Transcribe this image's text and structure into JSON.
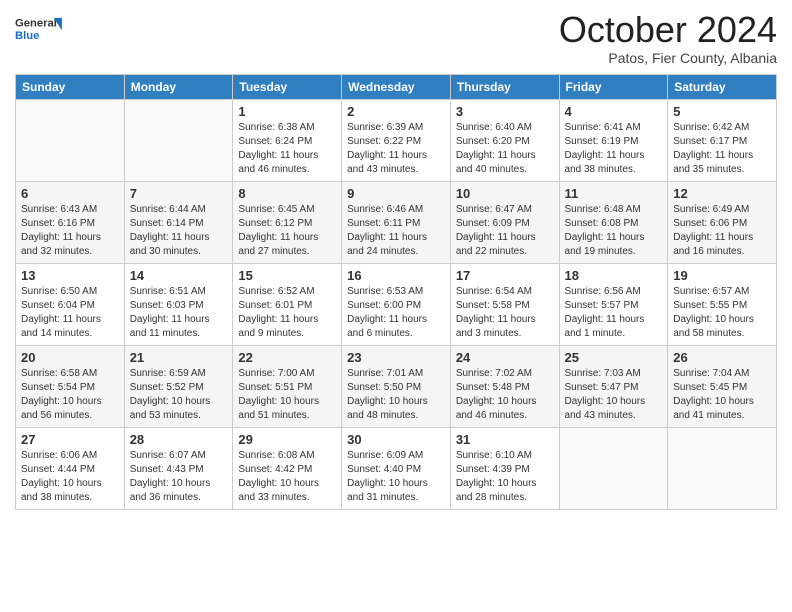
{
  "header": {
    "logo_general": "General",
    "logo_blue": "Blue",
    "month": "October 2024",
    "location": "Patos, Fier County, Albania"
  },
  "weekdays": [
    "Sunday",
    "Monday",
    "Tuesday",
    "Wednesday",
    "Thursday",
    "Friday",
    "Saturday"
  ],
  "weeks": [
    [
      {
        "day": "",
        "sunrise": "",
        "sunset": "",
        "daylight": ""
      },
      {
        "day": "",
        "sunrise": "",
        "sunset": "",
        "daylight": ""
      },
      {
        "day": "1",
        "sunrise": "Sunrise: 6:38 AM",
        "sunset": "Sunset: 6:24 PM",
        "daylight": "Daylight: 11 hours and 46 minutes."
      },
      {
        "day": "2",
        "sunrise": "Sunrise: 6:39 AM",
        "sunset": "Sunset: 6:22 PM",
        "daylight": "Daylight: 11 hours and 43 minutes."
      },
      {
        "day": "3",
        "sunrise": "Sunrise: 6:40 AM",
        "sunset": "Sunset: 6:20 PM",
        "daylight": "Daylight: 11 hours and 40 minutes."
      },
      {
        "day": "4",
        "sunrise": "Sunrise: 6:41 AM",
        "sunset": "Sunset: 6:19 PM",
        "daylight": "Daylight: 11 hours and 38 minutes."
      },
      {
        "day": "5",
        "sunrise": "Sunrise: 6:42 AM",
        "sunset": "Sunset: 6:17 PM",
        "daylight": "Daylight: 11 hours and 35 minutes."
      }
    ],
    [
      {
        "day": "6",
        "sunrise": "Sunrise: 6:43 AM",
        "sunset": "Sunset: 6:16 PM",
        "daylight": "Daylight: 11 hours and 32 minutes."
      },
      {
        "day": "7",
        "sunrise": "Sunrise: 6:44 AM",
        "sunset": "Sunset: 6:14 PM",
        "daylight": "Daylight: 11 hours and 30 minutes."
      },
      {
        "day": "8",
        "sunrise": "Sunrise: 6:45 AM",
        "sunset": "Sunset: 6:12 PM",
        "daylight": "Daylight: 11 hours and 27 minutes."
      },
      {
        "day": "9",
        "sunrise": "Sunrise: 6:46 AM",
        "sunset": "Sunset: 6:11 PM",
        "daylight": "Daylight: 11 hours and 24 minutes."
      },
      {
        "day": "10",
        "sunrise": "Sunrise: 6:47 AM",
        "sunset": "Sunset: 6:09 PM",
        "daylight": "Daylight: 11 hours and 22 minutes."
      },
      {
        "day": "11",
        "sunrise": "Sunrise: 6:48 AM",
        "sunset": "Sunset: 6:08 PM",
        "daylight": "Daylight: 11 hours and 19 minutes."
      },
      {
        "day": "12",
        "sunrise": "Sunrise: 6:49 AM",
        "sunset": "Sunset: 6:06 PM",
        "daylight": "Daylight: 11 hours and 16 minutes."
      }
    ],
    [
      {
        "day": "13",
        "sunrise": "Sunrise: 6:50 AM",
        "sunset": "Sunset: 6:04 PM",
        "daylight": "Daylight: 11 hours and 14 minutes."
      },
      {
        "day": "14",
        "sunrise": "Sunrise: 6:51 AM",
        "sunset": "Sunset: 6:03 PM",
        "daylight": "Daylight: 11 hours and 11 minutes."
      },
      {
        "day": "15",
        "sunrise": "Sunrise: 6:52 AM",
        "sunset": "Sunset: 6:01 PM",
        "daylight": "Daylight: 11 hours and 9 minutes."
      },
      {
        "day": "16",
        "sunrise": "Sunrise: 6:53 AM",
        "sunset": "Sunset: 6:00 PM",
        "daylight": "Daylight: 11 hours and 6 minutes."
      },
      {
        "day": "17",
        "sunrise": "Sunrise: 6:54 AM",
        "sunset": "Sunset: 5:58 PM",
        "daylight": "Daylight: 11 hours and 3 minutes."
      },
      {
        "day": "18",
        "sunrise": "Sunrise: 6:56 AM",
        "sunset": "Sunset: 5:57 PM",
        "daylight": "Daylight: 11 hours and 1 minute."
      },
      {
        "day": "19",
        "sunrise": "Sunrise: 6:57 AM",
        "sunset": "Sunset: 5:55 PM",
        "daylight": "Daylight: 10 hours and 58 minutes."
      }
    ],
    [
      {
        "day": "20",
        "sunrise": "Sunrise: 6:58 AM",
        "sunset": "Sunset: 5:54 PM",
        "daylight": "Daylight: 10 hours and 56 minutes."
      },
      {
        "day": "21",
        "sunrise": "Sunrise: 6:59 AM",
        "sunset": "Sunset: 5:52 PM",
        "daylight": "Daylight: 10 hours and 53 minutes."
      },
      {
        "day": "22",
        "sunrise": "Sunrise: 7:00 AM",
        "sunset": "Sunset: 5:51 PM",
        "daylight": "Daylight: 10 hours and 51 minutes."
      },
      {
        "day": "23",
        "sunrise": "Sunrise: 7:01 AM",
        "sunset": "Sunset: 5:50 PM",
        "daylight": "Daylight: 10 hours and 48 minutes."
      },
      {
        "day": "24",
        "sunrise": "Sunrise: 7:02 AM",
        "sunset": "Sunset: 5:48 PM",
        "daylight": "Daylight: 10 hours and 46 minutes."
      },
      {
        "day": "25",
        "sunrise": "Sunrise: 7:03 AM",
        "sunset": "Sunset: 5:47 PM",
        "daylight": "Daylight: 10 hours and 43 minutes."
      },
      {
        "day": "26",
        "sunrise": "Sunrise: 7:04 AM",
        "sunset": "Sunset: 5:45 PM",
        "daylight": "Daylight: 10 hours and 41 minutes."
      }
    ],
    [
      {
        "day": "27",
        "sunrise": "Sunrise: 6:06 AM",
        "sunset": "Sunset: 4:44 PM",
        "daylight": "Daylight: 10 hours and 38 minutes."
      },
      {
        "day": "28",
        "sunrise": "Sunrise: 6:07 AM",
        "sunset": "Sunset: 4:43 PM",
        "daylight": "Daylight: 10 hours and 36 minutes."
      },
      {
        "day": "29",
        "sunrise": "Sunrise: 6:08 AM",
        "sunset": "Sunset: 4:42 PM",
        "daylight": "Daylight: 10 hours and 33 minutes."
      },
      {
        "day": "30",
        "sunrise": "Sunrise: 6:09 AM",
        "sunset": "Sunset: 4:40 PM",
        "daylight": "Daylight: 10 hours and 31 minutes."
      },
      {
        "day": "31",
        "sunrise": "Sunrise: 6:10 AM",
        "sunset": "Sunset: 4:39 PM",
        "daylight": "Daylight: 10 hours and 28 minutes."
      },
      {
        "day": "",
        "sunrise": "",
        "sunset": "",
        "daylight": ""
      },
      {
        "day": "",
        "sunrise": "",
        "sunset": "",
        "daylight": ""
      }
    ]
  ]
}
